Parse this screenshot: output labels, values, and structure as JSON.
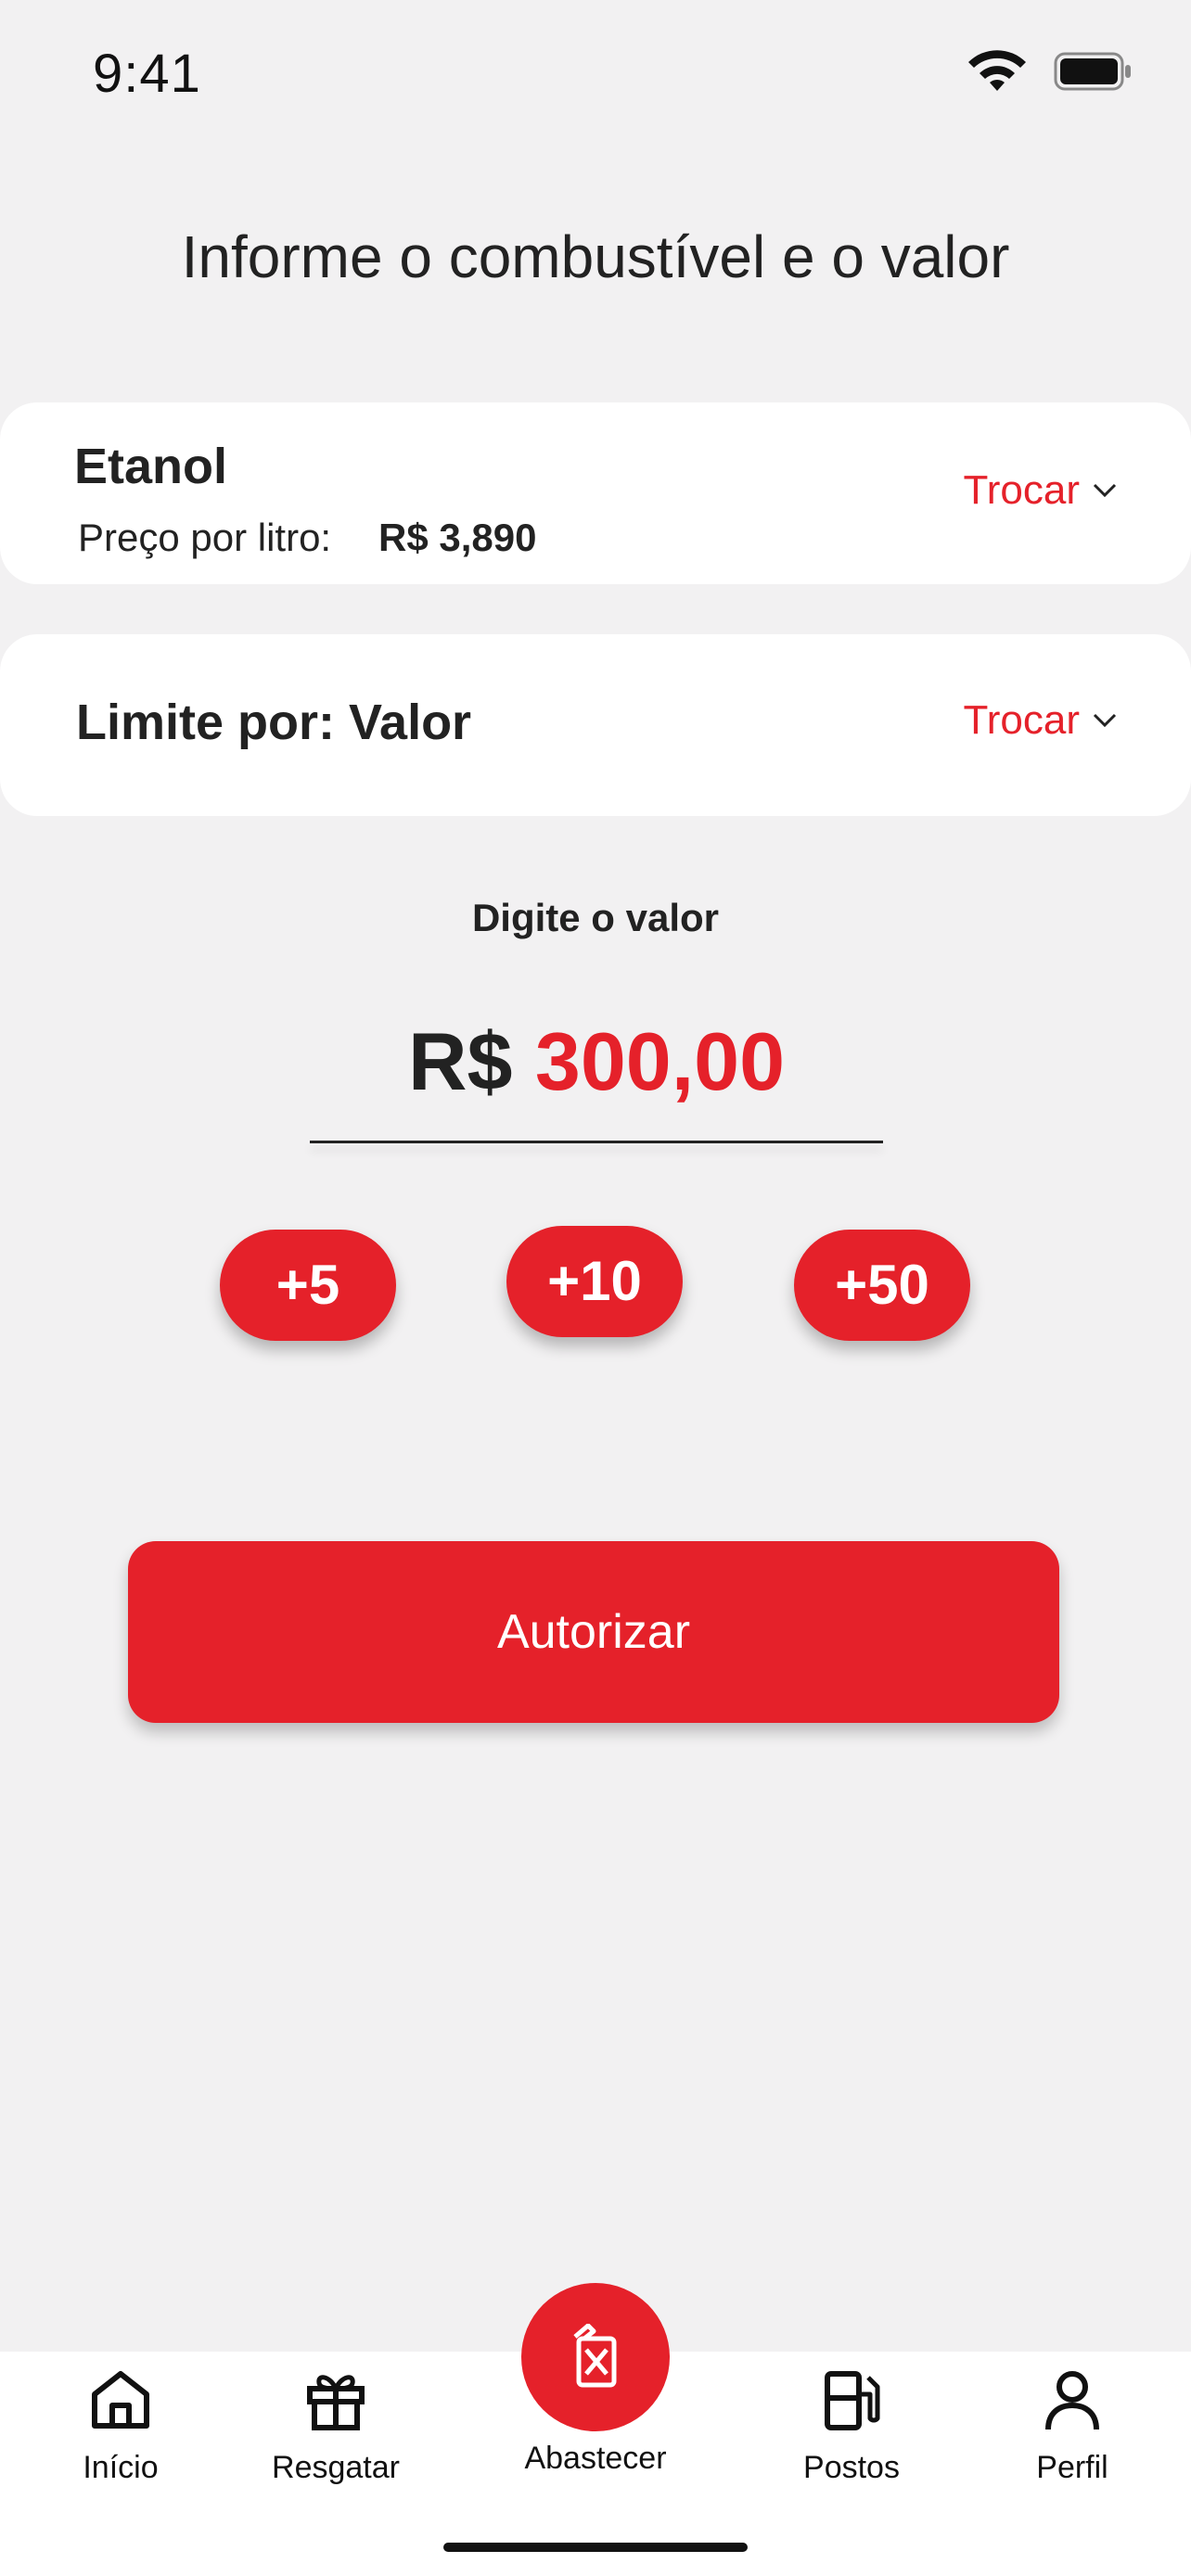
{
  "status_bar": {
    "time": "9:41",
    "icons": [
      "wifi-icon",
      "battery-icon"
    ]
  },
  "page": {
    "title": "Informe o combustível e o valor"
  },
  "fuel_card": {
    "fuel_name": "Etanol",
    "price_label": "Preço por litro:",
    "price_value": "R$ 3,890",
    "change_label": "Trocar"
  },
  "limit_card": {
    "label": "Limite por: Valor",
    "change_label": "Trocar"
  },
  "amount": {
    "label": "Digite o valor",
    "currency": "R$",
    "value": "300,00"
  },
  "quick_add": [
    {
      "label": "+5"
    },
    {
      "label": "+10"
    },
    {
      "label": "+50"
    }
  ],
  "actions": {
    "authorize_label": "Autorizar"
  },
  "bottom_nav": {
    "items": [
      {
        "label": "Início",
        "icon": "home-icon"
      },
      {
        "label": "Resgatar",
        "icon": "gift-icon"
      },
      {
        "label": "Abastecer",
        "icon": "fuel-can-icon"
      },
      {
        "label": "Postos",
        "icon": "gas-station-icon"
      },
      {
        "label": "Perfil",
        "icon": "user-icon"
      }
    ]
  },
  "colors": {
    "accent": "#e5212a",
    "background": "#f2f1f2",
    "surface": "#ffffff",
    "text": "#222222"
  }
}
